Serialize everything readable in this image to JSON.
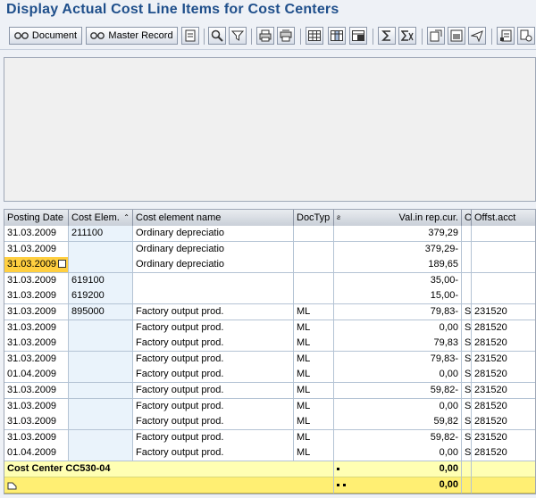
{
  "title": "Display Actual Cost Line Items for Cost Centers",
  "toolbar": {
    "document_label": "Document",
    "master_record_label": "Master Record"
  },
  "table": {
    "columns": [
      "Posting Date",
      "Cost Elem.",
      "Cost element name",
      "DocTyp",
      "Val.in rep.cur.",
      "O",
      "Offst.acct"
    ],
    "rows": [
      {
        "date": "31.03.2009",
        "elem": "211100",
        "name": "Ordinary depreciatio",
        "doctyp": "",
        "val": "379,29",
        "o": "",
        "offst": ""
      },
      {
        "date": "31.03.2009",
        "elem": "",
        "name": "Ordinary depreciatio",
        "doctyp": "",
        "val": "379,29-",
        "o": "",
        "offst": ""
      },
      {
        "date": "31.03.2009",
        "elem": "",
        "name": "Ordinary depreciatio",
        "doctyp": "",
        "val": "189,65",
        "o": "",
        "offst": ""
      },
      {
        "date": "31.03.2009",
        "elem": "619100",
        "name": "",
        "doctyp": "",
        "val": "35,00-",
        "o": "",
        "offst": ""
      },
      {
        "date": "31.03.2009",
        "elem": "619200",
        "name": "",
        "doctyp": "",
        "val": "15,00-",
        "o": "",
        "offst": ""
      },
      {
        "date": "31.03.2009",
        "elem": "895000",
        "name": "Factory output prod.",
        "doctyp": "ML",
        "val": "79,83-",
        "o": "S",
        "offst": "231520"
      },
      {
        "date": "31.03.2009",
        "elem": "",
        "name": "Factory output prod.",
        "doctyp": "ML",
        "val": "0,00",
        "o": "S",
        "offst": "281520"
      },
      {
        "date": "31.03.2009",
        "elem": "",
        "name": "Factory output prod.",
        "doctyp": "ML",
        "val": "79,83",
        "o": "S",
        "offst": "281520"
      },
      {
        "date": "31.03.2009",
        "elem": "",
        "name": "Factory output prod.",
        "doctyp": "ML",
        "val": "79,83-",
        "o": "S",
        "offst": "231520"
      },
      {
        "date": "01.04.2009",
        "elem": "",
        "name": "Factory output prod.",
        "doctyp": "ML",
        "val": "0,00",
        "o": "S",
        "offst": "281520"
      },
      {
        "date": "31.03.2009",
        "elem": "",
        "name": "Factory output prod.",
        "doctyp": "ML",
        "val": "59,82-",
        "o": "S",
        "offst": "231520"
      },
      {
        "date": "31.03.2009",
        "elem": "",
        "name": "Factory output prod.",
        "doctyp": "ML",
        "val": "0,00",
        "o": "S",
        "offst": "281520"
      },
      {
        "date": "31.03.2009",
        "elem": "",
        "name": "Factory output prod.",
        "doctyp": "ML",
        "val": "59,82",
        "o": "S",
        "offst": "281520"
      },
      {
        "date": "31.03.2009",
        "elem": "",
        "name": "Factory output prod.",
        "doctyp": "ML",
        "val": "59,82-",
        "o": "S",
        "offst": "231520"
      },
      {
        "date": "01.04.2009",
        "elem": "",
        "name": "Factory output prod.",
        "doctyp": "ML",
        "val": "0,00",
        "o": "S",
        "offst": "281520"
      }
    ],
    "subtotal": {
      "label": "Cost Center CC530-04",
      "val": "0,00"
    },
    "total": {
      "val": "0,00"
    }
  }
}
